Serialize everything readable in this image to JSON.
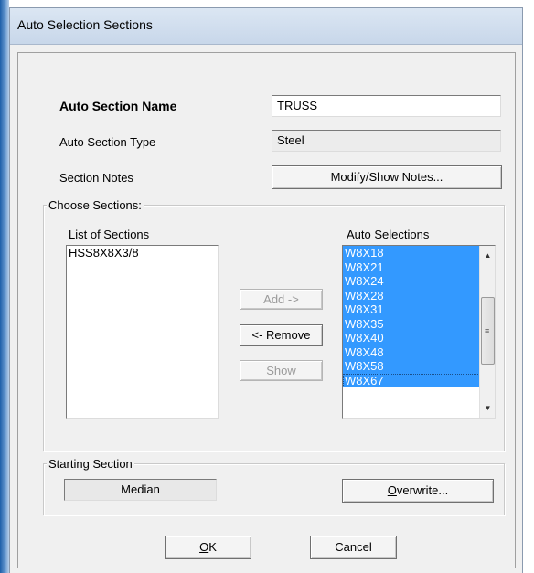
{
  "window": {
    "title": "Auto Selection Sections"
  },
  "fields": {
    "name_label": "Auto Section Name",
    "name_value": "TRUSS",
    "type_label": "Auto Section Type",
    "type_value": "Steel",
    "notes_label": "Section Notes",
    "notes_button": "Modify/Show Notes..."
  },
  "choose": {
    "legend": "Choose Sections:",
    "list_label": "List of Sections",
    "list_items": [
      "HSS8X8X3/8"
    ],
    "auto_label": "Auto Selections",
    "auto_items": [
      "W8X18",
      "W8X21",
      "W8X24",
      "W8X28",
      "W8X31",
      "W8X35",
      "W8X40",
      "W8X48",
      "W8X58",
      "W8X67"
    ],
    "add_button": "Add ->",
    "remove_button": "<- Remove",
    "show_button": "Show"
  },
  "starting": {
    "legend": "Starting Section",
    "value": "Median",
    "overwrite_prefix": "",
    "overwrite_mnemonic": "O",
    "overwrite_rest": "verwrite..."
  },
  "footer": {
    "ok_mnemonic": "O",
    "ok_rest": "K",
    "cancel_label": "Cancel"
  }
}
